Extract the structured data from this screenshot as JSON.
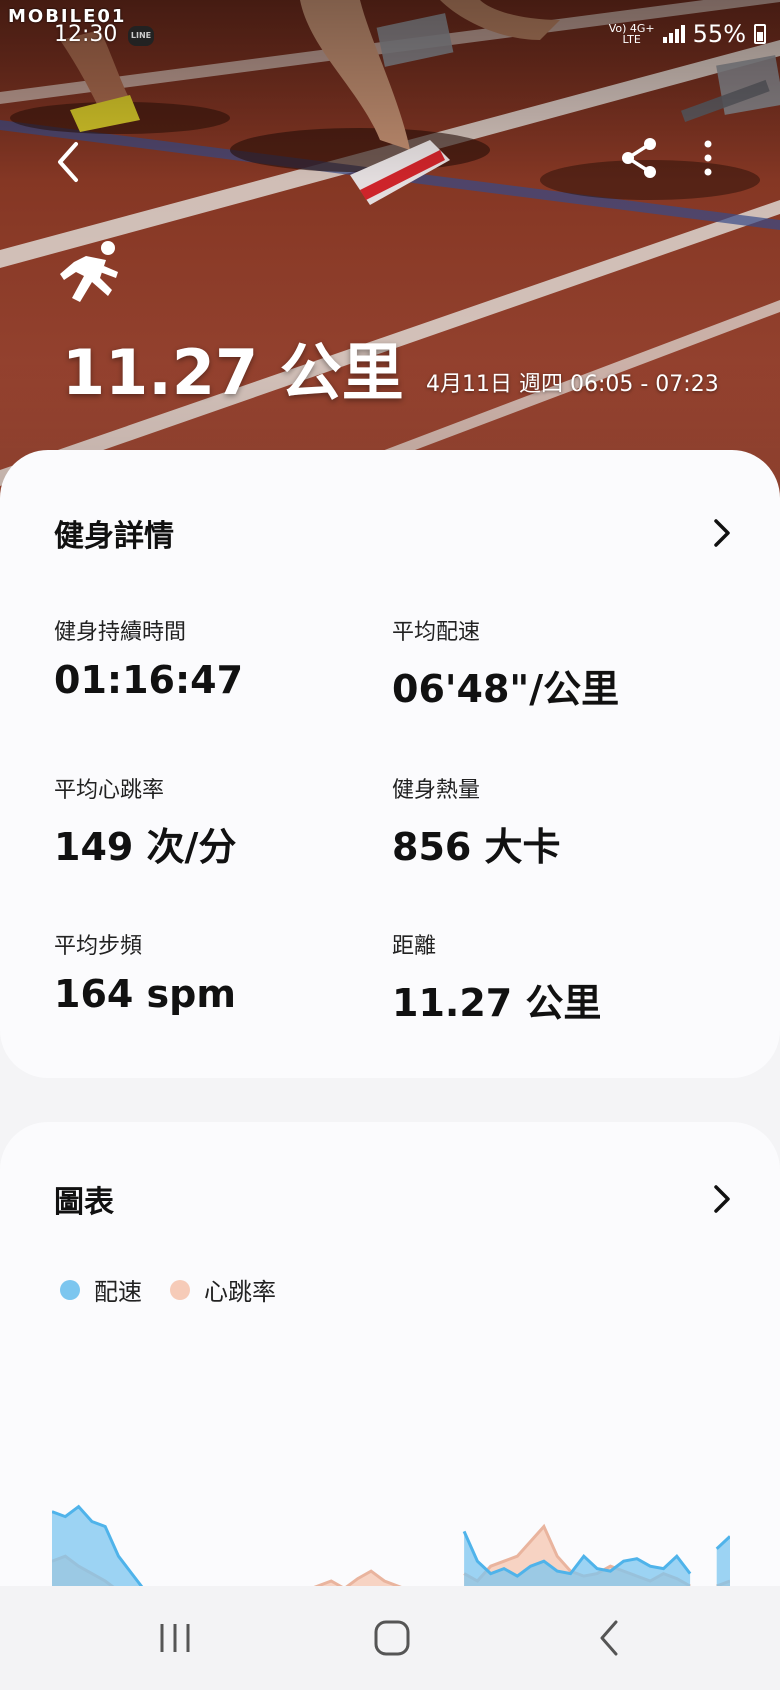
{
  "status_bar": {
    "watermark": "MOBILE01",
    "time": "12:30",
    "line_badge": "LINE",
    "network_top": "Vo) 4G+",
    "network_bottom": "LTE",
    "battery": "55%"
  },
  "hero": {
    "title": "11.27 公里",
    "datetime": "4月11日 週四 06:05 - 07:23",
    "icons": [
      "back-arrow-icon",
      "share-icon",
      "more-vertical-icon",
      "running-icon"
    ]
  },
  "details_card": {
    "title": "健身詳情",
    "stats": [
      {
        "label": "健身持續時間",
        "value": "01:16:47"
      },
      {
        "label": "平均配速",
        "value": "06'48\"/公里"
      },
      {
        "label": "平均心跳率",
        "value": "149 次/分"
      },
      {
        "label": "健身熱量",
        "value": "856 大卡"
      },
      {
        "label": "平均步頻",
        "value": "164 spm"
      },
      {
        "label": "距離",
        "value": "11.27 公里"
      }
    ]
  },
  "chart_card": {
    "title": "圖表",
    "legend": [
      {
        "label": "配速",
        "color": "#7cc6ef"
      },
      {
        "label": "心跳率",
        "color": "#f6cbb8"
      }
    ]
  },
  "chart_data": {
    "type": "area",
    "title": "",
    "xlabel": "",
    "ylabel": "",
    "series": [
      {
        "name": "配速",
        "color": "#7cc6ef",
        "values": [
          0.8,
          0.78,
          0.82,
          0.76,
          0.74,
          0.62,
          0.55,
          0.48,
          0.42,
          0.44,
          0.4,
          0.38,
          0.41,
          0.36,
          0.38,
          0.42,
          0.4,
          0.44,
          0.43,
          0.41,
          0.45,
          0.46,
          0.44,
          0.42,
          0.47,
          0.44,
          0.43,
          0.46,
          0.48,
          0.45,
          0.0,
          0.72,
          0.6,
          0.55,
          0.57,
          0.54,
          0.58,
          0.6,
          0.56,
          0.55,
          0.62,
          0.57,
          0.56,
          0.6,
          0.61,
          0.58,
          0.57,
          0.62,
          0.55,
          0.0,
          0.65,
          0.7
        ]
      },
      {
        "name": "心跳率",
        "color": "#f6cbb8",
        "values": [
          0.6,
          0.62,
          0.58,
          0.55,
          0.52,
          0.48,
          0.42,
          0.38,
          0.36,
          0.4,
          0.38,
          0.35,
          0.37,
          0.4,
          0.38,
          0.44,
          0.46,
          0.42,
          0.45,
          0.48,
          0.5,
          0.52,
          0.49,
          0.53,
          0.56,
          0.52,
          0.5,
          0.48,
          0.46,
          0.44,
          0.0,
          0.55,
          0.52,
          0.58,
          0.6,
          0.62,
          0.68,
          0.74,
          0.62,
          0.56,
          0.54,
          0.55,
          0.58,
          0.56,
          0.54,
          0.52,
          0.55,
          0.53,
          0.5,
          0.0,
          0.5,
          0.52
        ]
      }
    ]
  },
  "nav": {
    "buttons": [
      "recent-apps-icon",
      "home-icon",
      "back-icon"
    ]
  }
}
